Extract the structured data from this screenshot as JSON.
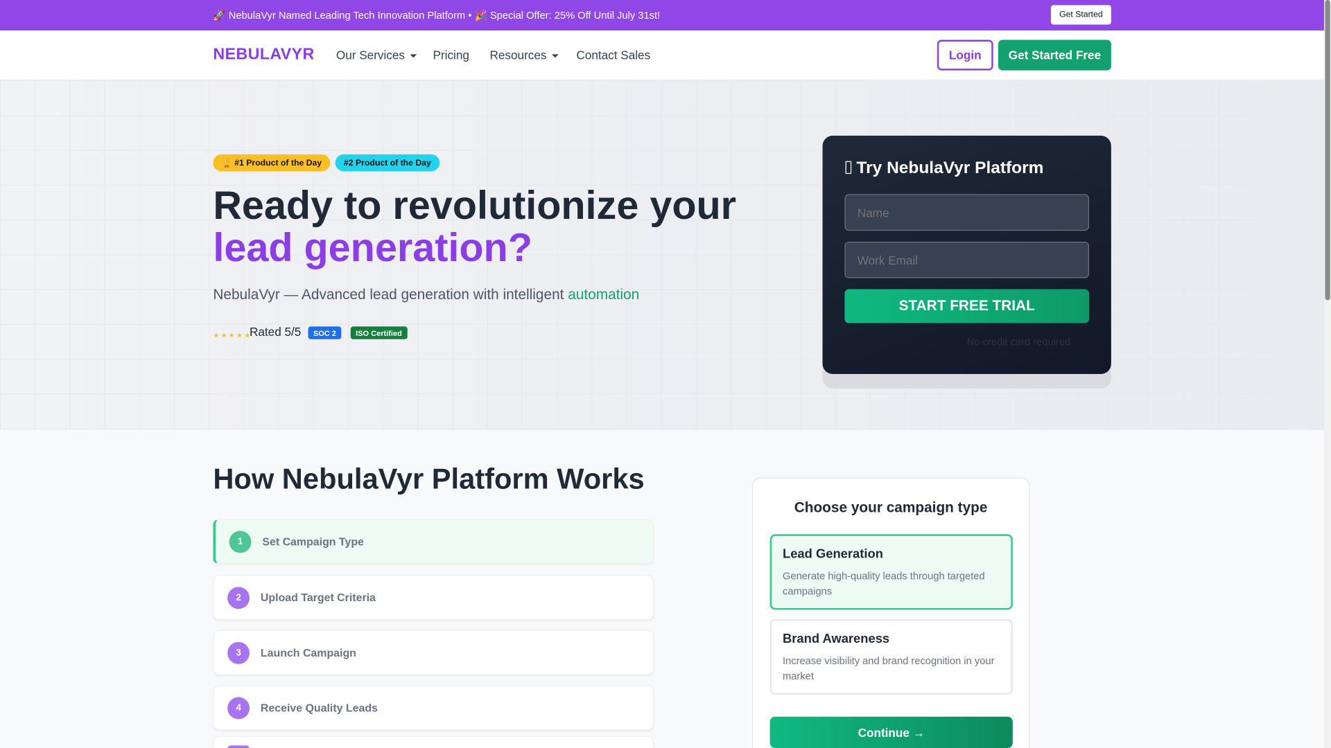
{
  "announcement": {
    "message": "🚀 NebulaVyr Named Leading Tech Innovation Platform • 🎉 Special Offer: 25% Off Until July 31st!",
    "button_label": "Get Started"
  },
  "nav": {
    "brand": "NEBULAVYR",
    "items": [
      {
        "label": "Our Services",
        "has_dropdown": true
      },
      {
        "label": "Pricing",
        "has_dropdown": false
      },
      {
        "label": "Resources",
        "has_dropdown": true
      },
      {
        "label": "Contact Sales",
        "has_dropdown": false
      }
    ],
    "login_label": "Login",
    "cta_label": "Get Started Free"
  },
  "hero": {
    "badges": [
      "🏆 #1 Product of the Day",
      "#2 Product of the Day"
    ],
    "headline_line1": "Ready to revolutionize your",
    "headline_line2": "lead generation?",
    "subtitle_prefix": "NebulaVyr — Advanced lead generation with intelligent ",
    "subtitle_highlight": "automation",
    "stars": "★★★★★",
    "rating_text": "Rated 5/5",
    "tags": [
      "SOC 2",
      "ISO Certified"
    ]
  },
  "trial_form": {
    "title": "Try NebulaVyr Platform",
    "title_icon": "rocket-icon",
    "name_placeholder": "Name",
    "email_placeholder": "Work Email",
    "submit_label": "START FREE TRIAL",
    "note": "No credit card required"
  },
  "how_it_works": {
    "title": "How NebulaVyr Platform Works",
    "steps": [
      {
        "num": "1",
        "label": "Set Campaign Type",
        "active": true
      },
      {
        "num": "2",
        "label": "Upload Target Criteria",
        "active": false
      },
      {
        "num": "3",
        "label": "Launch Campaign",
        "active": false
      },
      {
        "num": "4",
        "label": "Receive Quality Leads",
        "active": false
      }
    ]
  },
  "campaign_chooser": {
    "title": "Choose your campaign type",
    "options": [
      {
        "title": "Lead Generation",
        "description": "Generate high-quality leads through targeted campaigns",
        "selected": true
      },
      {
        "title": "Brand Awareness",
        "description": "Increase visibility and brand recognition in your market",
        "selected": false
      }
    ],
    "continue_label": "Continue →"
  },
  "colors": {
    "brand_purple": "#8b3ee6",
    "accent_green": "#12a26f",
    "announcement_bg": "#9146e8"
  }
}
